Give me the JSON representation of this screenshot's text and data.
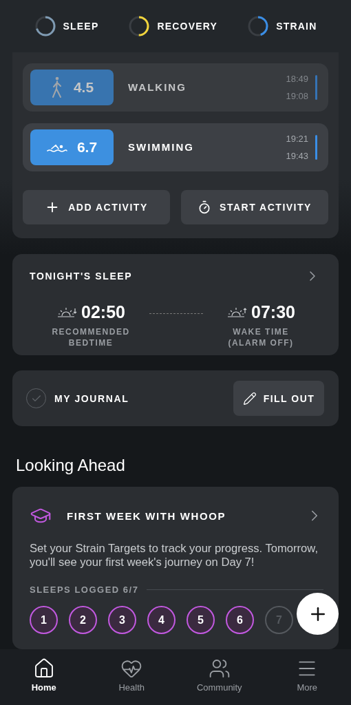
{
  "rings": [
    {
      "label": "SLEEP",
      "color": "#7f9bb3"
    },
    {
      "label": "RECOVERY",
      "color": "#f2d53c"
    },
    {
      "label": "STRAIN",
      "color": "#3a8ee6"
    }
  ],
  "activities": [
    {
      "kind": "walking",
      "score": "4.5",
      "name": "WALKING",
      "start": "18:49",
      "end": "19:08",
      "faded": true
    },
    {
      "kind": "swimming",
      "score": "6.7",
      "name": "SWIMMING",
      "start": "19:21",
      "end": "19:43",
      "faded": false
    }
  ],
  "activity_buttons": [
    {
      "kind": "add",
      "label": "ADD ACTIVITY"
    },
    {
      "kind": "start",
      "label": "START ACTIVITY"
    }
  ],
  "tonights_sleep": {
    "title": "TONIGHT'S SLEEP",
    "bedtime": {
      "time": "02:50",
      "label": "RECOMMENDED BEDTIME"
    },
    "wake": {
      "time": "07:30",
      "label": "WAKE TIME (ALARM OFF)"
    }
  },
  "journal": {
    "label": "MY JOURNAL",
    "button": "FILL OUT"
  },
  "section_title": "Looking Ahead",
  "first_week": {
    "title": "FIRST WEEK WITH WHOOP",
    "text": "Set your Strain Targets to track your progress. Tomorrow, you'll see your first week's journey on Day 7!",
    "progress_label": "SLEEPS LOGGED 6/7",
    "days": [
      {
        "label": "1",
        "logged": true
      },
      {
        "label": "2",
        "logged": true
      },
      {
        "label": "3",
        "logged": true
      },
      {
        "label": "4",
        "logged": true
      },
      {
        "label": "5",
        "logged": true
      },
      {
        "label": "6",
        "logged": true
      },
      {
        "label": "7",
        "logged": false
      }
    ]
  },
  "nav": [
    {
      "kind": "home",
      "label": "Home",
      "selected": true
    },
    {
      "kind": "health",
      "label": "Health",
      "selected": false
    },
    {
      "kind": "community",
      "label": "Community",
      "selected": false
    },
    {
      "kind": "more",
      "label": "More",
      "selected": false
    }
  ]
}
